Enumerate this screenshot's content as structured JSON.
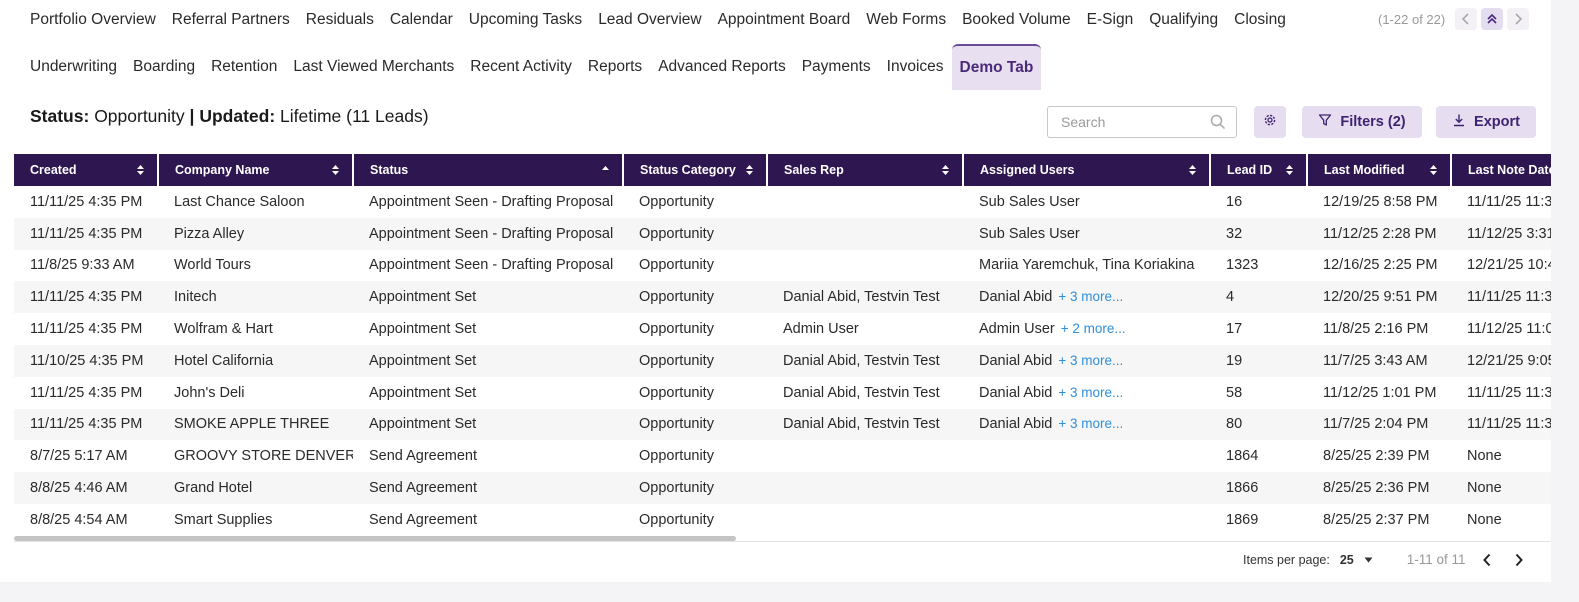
{
  "tabs_row1": [
    "Portfolio Overview",
    "Referral Partners",
    "Residuals",
    "Calendar",
    "Upcoming Tasks",
    "Lead Overview",
    "Appointment Board",
    "Web Forms",
    "Booked Volume",
    "E-Sign",
    "Qualifying",
    "Closing"
  ],
  "tabs_row2": [
    "Underwriting",
    "Boarding",
    "Retention",
    "Last Viewed Merchants",
    "Recent Activity",
    "Reports",
    "Advanced Reports",
    "Payments",
    "Invoices",
    "Demo Tab"
  ],
  "active_tab": "Demo Tab",
  "tabs_pager": "(1-22 of 22)",
  "status": {
    "status_label": "Status:",
    "status_value": "Opportunity",
    "sep": "|",
    "updated_label": "Updated:",
    "updated_value": "Lifetime (11 Leads)"
  },
  "search": {
    "placeholder": "Search"
  },
  "toolbar": {
    "filters_label": "Filters (2)",
    "export_label": "Export"
  },
  "table": {
    "columns": [
      "Created",
      "Company Name",
      "Status",
      "Status Category",
      "Sales Rep",
      "Assigned Users",
      "Lead ID",
      "Last Modified",
      "Last Note Date"
    ],
    "rows": [
      {
        "created": "11/11/25 4:35 PM",
        "company": "Last Chance Saloon",
        "status": "Appointment Seen - Drafting Proposal",
        "category": "Opportunity",
        "sales_rep": "",
        "assigned": "Sub Sales User",
        "more": "",
        "lead_id": "16",
        "modified": "12/19/25 8:58 PM",
        "note": "11/11/25 11:3"
      },
      {
        "created": "11/11/25 4:35 PM",
        "company": "Pizza Alley",
        "status": "Appointment Seen - Drafting Proposal",
        "category": "Opportunity",
        "sales_rep": "",
        "assigned": "Sub Sales User",
        "more": "",
        "lead_id": "32",
        "modified": "11/12/25 2:28 PM",
        "note": "11/12/25 3:31"
      },
      {
        "created": "11/8/25 9:33 AM",
        "company": "World Tours",
        "status": "Appointment Seen - Drafting Proposal",
        "category": "Opportunity",
        "sales_rep": "",
        "assigned": "Mariia Yaremchuk,  Tina Koriakina",
        "more": "",
        "lead_id": "1323",
        "modified": "12/16/25 2:25 PM",
        "note": "12/21/25 10:4"
      },
      {
        "created": "11/11/25 4:35 PM",
        "company": "Initech",
        "status": "Appointment Set",
        "category": "Opportunity",
        "sales_rep": "Danial Abid,  Testvin Test",
        "assigned": "Danial Abid",
        "more": "+ 3 more...",
        "lead_id": "4",
        "modified": "12/20/25 9:51 PM",
        "note": "11/11/25 11:3"
      },
      {
        "created": "11/11/25 4:35 PM",
        "company": "Wolfram & Hart",
        "status": "Appointment Set",
        "category": "Opportunity",
        "sales_rep": "Admin User",
        "assigned": "Admin User",
        "more": "+ 2 more...",
        "lead_id": "17",
        "modified": "11/8/25 2:16 PM",
        "note": "11/12/25 11:0"
      },
      {
        "created": "11/10/25 4:35 PM",
        "company": "Hotel California",
        "status": "Appointment Set",
        "category": "Opportunity",
        "sales_rep": "Danial Abid,  Testvin Test",
        "assigned": "Danial Abid",
        "more": "+ 3 more...",
        "lead_id": "19",
        "modified": "11/7/25 3:43 AM",
        "note": "12/21/25 9:05"
      },
      {
        "created": "11/11/25 4:35 PM",
        "company": "John's Deli",
        "status": "Appointment Set",
        "category": "Opportunity",
        "sales_rep": "Danial Abid,  Testvin Test",
        "assigned": "Danial Abid",
        "more": "+ 3 more...",
        "lead_id": "58",
        "modified": "11/12/25 1:01 PM",
        "note": "11/11/25 11:3"
      },
      {
        "created": "11/11/25 4:35 PM",
        "company": "SMOKE APPLE THREE",
        "status": "Appointment Set",
        "category": "Opportunity",
        "sales_rep": "Danial Abid,  Testvin Test",
        "assigned": "Danial Abid",
        "more": "+ 3 more...",
        "lead_id": "80",
        "modified": "11/7/25 2:04 PM",
        "note": "11/11/25 11:3"
      },
      {
        "created": "8/7/25 5:17 AM",
        "company": "GROOVY STORE DENVER",
        "status": "Send Agreement",
        "category": "Opportunity",
        "sales_rep": "",
        "assigned": "",
        "more": "",
        "lead_id": "1864",
        "modified": "8/25/25 2:39 PM",
        "note": "None"
      },
      {
        "created": "8/8/25 4:46 AM",
        "company": "Grand Hotel",
        "status": "Send Agreement",
        "category": "Opportunity",
        "sales_rep": "",
        "assigned": "",
        "more": "",
        "lead_id": "1866",
        "modified": "8/25/25 2:36 PM",
        "note": "None"
      },
      {
        "created": "8/8/25 4:54 AM",
        "company": "Smart Supplies",
        "status": "Send Agreement",
        "category": "Opportunity",
        "sales_rep": "",
        "assigned": "",
        "more": "",
        "lead_id": "1869",
        "modified": "8/25/25 2:37 PM",
        "note": "None"
      }
    ]
  },
  "footer": {
    "items_per_page_label": "Items per page:",
    "items_per_page_value": "25",
    "range": "1-11 of 11"
  },
  "colors": {
    "header_bg": "#2e1650",
    "accent_bg": "#e6ddf0",
    "accent_text": "#3e2470",
    "link": "#2f8fdc"
  },
  "icons": [
    "chevron-left-icon",
    "double-chevron-up-icon",
    "chevron-right-icon",
    "search-icon",
    "gear-icon",
    "filter-icon",
    "download-icon",
    "sort-icon",
    "sort-asc-icon",
    "caret-down-icon"
  ]
}
